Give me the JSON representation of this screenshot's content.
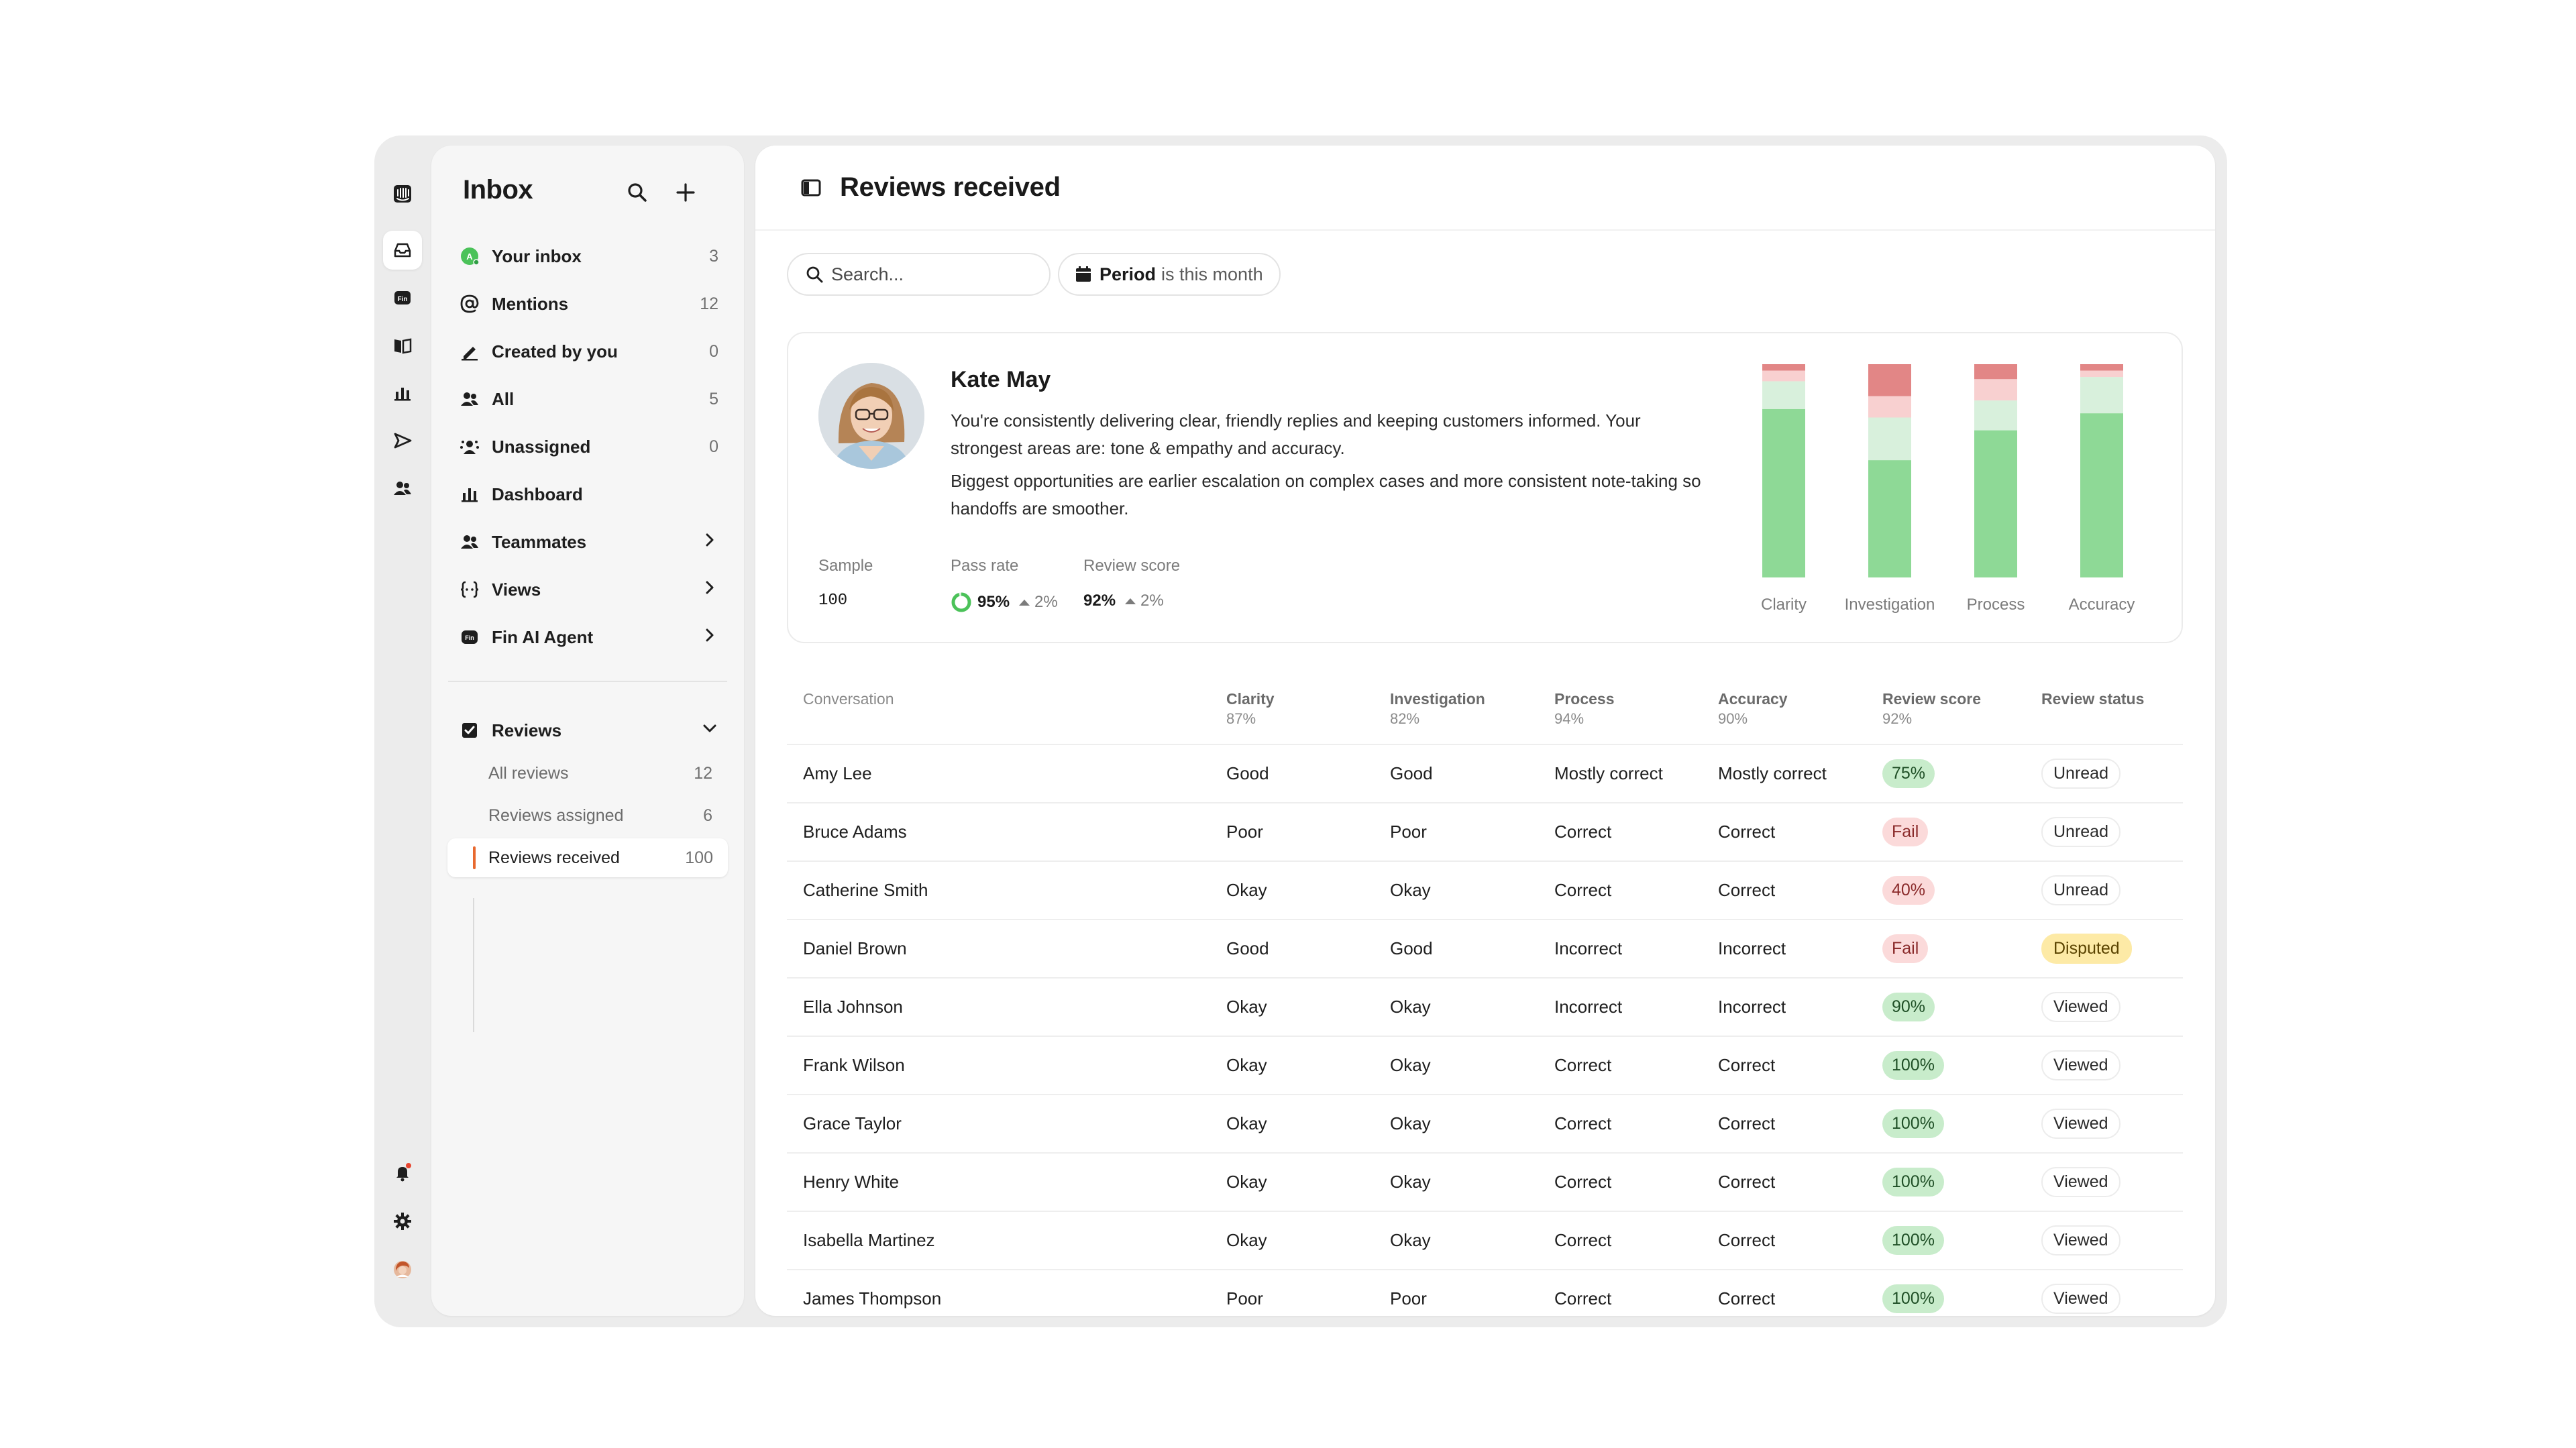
{
  "inbox": {
    "title": "Inbox",
    "nav": [
      {
        "label": "Your inbox",
        "count": "3",
        "icon": "user-avatar-icon"
      },
      {
        "label": "Mentions",
        "count": "12",
        "icon": "at-icon"
      },
      {
        "label": "Created by you",
        "count": "0",
        "icon": "pen-icon"
      },
      {
        "label": "All",
        "count": "5",
        "icon": "people-icon"
      },
      {
        "label": "Unassigned",
        "count": "0",
        "icon": "unassigned-icon"
      },
      {
        "label": "Dashboard",
        "count": "",
        "icon": "bar-chart-icon"
      },
      {
        "label": "Teammates",
        "count": "",
        "icon": "people-icon"
      },
      {
        "label": "Views",
        "count": "",
        "icon": "views-icon"
      },
      {
        "label": "Fin AI Agent",
        "count": "",
        "icon": "fin-icon"
      }
    ],
    "reviews": {
      "label": "Reviews",
      "items": [
        {
          "label": "All reviews",
          "count": "12"
        },
        {
          "label": "Reviews assigned",
          "count": "6"
        },
        {
          "label": "Reviews received",
          "count": "100"
        }
      ]
    }
  },
  "main": {
    "title": "Reviews received",
    "search_placeholder": "Search...",
    "filter": {
      "key": "Period",
      "value": "is this month"
    }
  },
  "summary": {
    "name": "Kate May",
    "paragraph1": "You're consistently delivering clear, friendly replies and keeping customers informed. Your strongest areas are: tone & empathy and accuracy.",
    "paragraph2": "Biggest opportunities are earlier escalation on complex cases and more consistent note-taking so handoffs are smoother.",
    "stats": {
      "sample_label": "Sample",
      "sample_value": "100",
      "pass_label": "Pass rate",
      "pass_value": "95%",
      "pass_delta": "2%",
      "score_label": "Review score",
      "score_value": "92%",
      "score_delta": "2%"
    }
  },
  "chart_data": {
    "type": "bar",
    "stacked": true,
    "categories": [
      "Clarity",
      "Investigation",
      "Process",
      "Accuracy"
    ],
    "series": [
      {
        "color": "#8ed996",
        "values": [
          79,
          55,
          69,
          77
        ]
      },
      {
        "color": "#d8f0dc",
        "values": [
          13,
          20,
          14,
          17
        ]
      },
      {
        "color": "#f8d0d0",
        "values": [
          5,
          10,
          10,
          3
        ]
      },
      {
        "color": "#e28686",
        "values": [
          3,
          15,
          7,
          3
        ]
      }
    ]
  },
  "table": {
    "headers": [
      {
        "name": "Conversation",
        "pct": ""
      },
      {
        "name": "Clarity",
        "pct": "87%"
      },
      {
        "name": "Investigation",
        "pct": "82%"
      },
      {
        "name": "Process",
        "pct": "94%"
      },
      {
        "name": "Accuracy",
        "pct": "90%"
      },
      {
        "name": "Review score",
        "pct": "92%"
      },
      {
        "name": "Review status",
        "pct": ""
      }
    ],
    "rows": [
      {
        "name": "Amy Lee",
        "clarity": "Good",
        "investigation": "Good",
        "process": "Mostly correct",
        "accuracy": "Mostly correct",
        "score": "75%",
        "score_tone": "green",
        "status": "Unread"
      },
      {
        "name": "Bruce Adams",
        "clarity": "Poor",
        "investigation": "Poor",
        "process": "Correct",
        "accuracy": "Correct",
        "score": "Fail",
        "score_tone": "red",
        "status": "Unread"
      },
      {
        "name": "Catherine Smith",
        "clarity": "Okay",
        "investigation": "Okay",
        "process": "Correct",
        "accuracy": "Correct",
        "score": "40%",
        "score_tone": "red",
        "status": "Unread"
      },
      {
        "name": "Daniel Brown",
        "clarity": "Good",
        "investigation": "Good",
        "process": "Incorrect",
        "accuracy": "Incorrect",
        "score": "Fail",
        "score_tone": "red",
        "status": "Disputed"
      },
      {
        "name": "Ella Johnson",
        "clarity": "Okay",
        "investigation": "Okay",
        "process": "Incorrect",
        "accuracy": "Incorrect",
        "score": "90%",
        "score_tone": "green",
        "status": "Viewed"
      },
      {
        "name": "Frank Wilson",
        "clarity": "Okay",
        "investigation": "Okay",
        "process": "Correct",
        "accuracy": "Correct",
        "score": "100%",
        "score_tone": "green",
        "status": "Viewed"
      },
      {
        "name": "Grace Taylor",
        "clarity": "Okay",
        "investigation": "Okay",
        "process": "Correct",
        "accuracy": "Correct",
        "score": "100%",
        "score_tone": "green",
        "status": "Viewed"
      },
      {
        "name": "Henry White",
        "clarity": "Okay",
        "investigation": "Okay",
        "process": "Correct",
        "accuracy": "Correct",
        "score": "100%",
        "score_tone": "green",
        "status": "Viewed"
      },
      {
        "name": "Isabella Martinez",
        "clarity": "Okay",
        "investigation": "Okay",
        "process": "Correct",
        "accuracy": "Correct",
        "score": "100%",
        "score_tone": "green",
        "status": "Viewed"
      },
      {
        "name": "James Thompson",
        "clarity": "Poor",
        "investigation": "Poor",
        "process": "Correct",
        "accuracy": "Correct",
        "score": "100%",
        "score_tone": "green",
        "status": "Viewed"
      }
    ]
  },
  "colors": {
    "accent": "#e8692f",
    "pass_green": "#4bc259",
    "disputed": "#fdeaa6"
  }
}
